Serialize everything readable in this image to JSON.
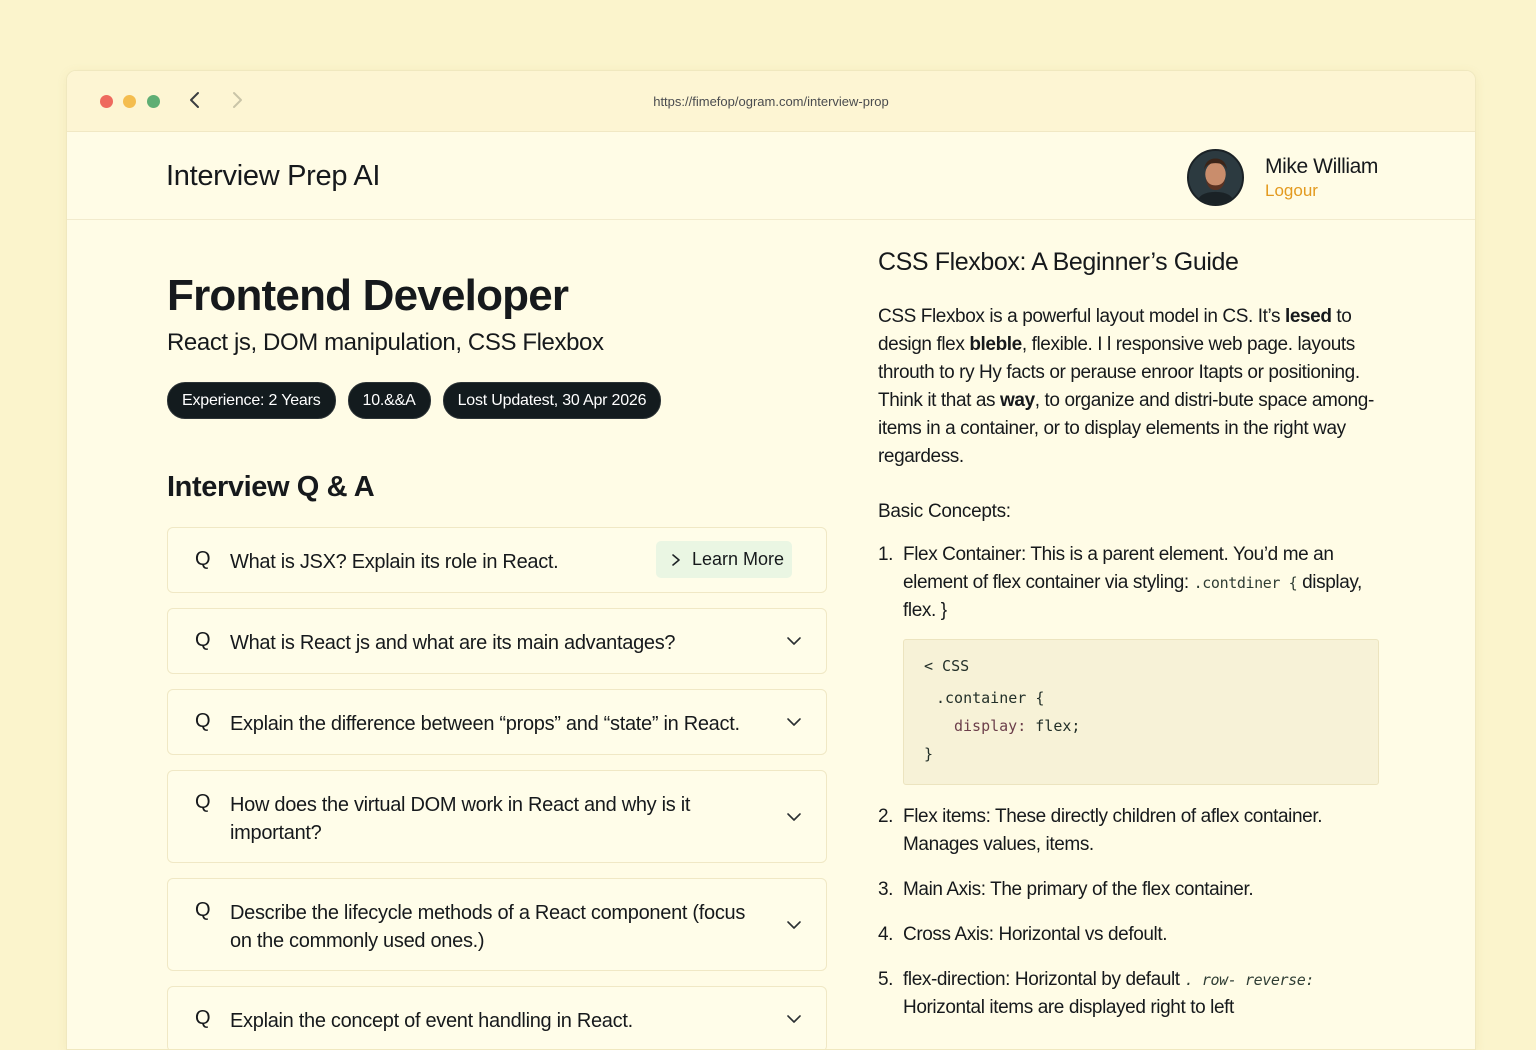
{
  "browser": {
    "url": "https://fimefop/ogram.com/interview-prop"
  },
  "header": {
    "brand": "Interview Prep AI",
    "user_name": "Mike William",
    "logout_label": "Logour"
  },
  "role": {
    "title": "Frontend Developer",
    "skills": "React js, DOM manipulation, CSS Flexbox",
    "chips": [
      "Experience: 2 Years",
      "10.&&A",
      "Lost Updatest, 30 Apr 2026"
    ]
  },
  "qa": {
    "heading": "Interview Q & A",
    "q_marker": "Q",
    "learn_more_label": "Learn More",
    "items": [
      "What is JSX? Explain its role in React.",
      "What is React js and what are its main advantages?",
      "Explain the difference between “props” and “state” in React.",
      "How does the virtual DOM work in React and why is it important?",
      "Describe the lifecycle methods of a React component (focus on the commonly used ones.)",
      "Explain the concept of event handling in React."
    ]
  },
  "article": {
    "title": "CSS Flexbox: A Beginner’s Guide",
    "intro_1": "CSS Flexbox is a powerful layout model in CS. It’s ",
    "intro_b1": "lesed",
    "intro_2": " to design flex ",
    "intro_b2": "bleble",
    "intro_3": ", flexible. I l responsive web page. layouts throuth to ry Hy facts or perause enroor Itapts or positioning. Think it that as ",
    "intro_b3": "way",
    "intro_4": ", to organize and distri-bute space among-items in a container, or to display elements in the right way regardess.",
    "basic_heading": "Basic Concepts:",
    "concepts": [
      {
        "num": "1.",
        "term": "Flex Container:",
        "text": " This is a parent element. You’d me an element of flex container via styling: ",
        "code": ".contdiner {",
        "text2": " display, flex. }"
      },
      {
        "num": "2.",
        "term": "Flex items:",
        "text": " These directly children of aflex container. Manages values, items."
      },
      {
        "num": "3.",
        "term": "Main Axis:",
        "text": " The primary of the flex container."
      },
      {
        "num": "4.",
        "term": "Cross Axis:",
        "text": " Horizontal vs defoult."
      },
      {
        "num": "5.",
        "term": "flex-direction:",
        "text": " Horizontal by default ",
        "code": ". row- reverse:",
        "text2": " Horizontal items are displayed right to left"
      }
    ],
    "code": {
      "lang": "< CSS",
      "line1": ".container {",
      "line2_key": "display:",
      "line2_val": " flex;",
      "line3": "}"
    }
  }
}
